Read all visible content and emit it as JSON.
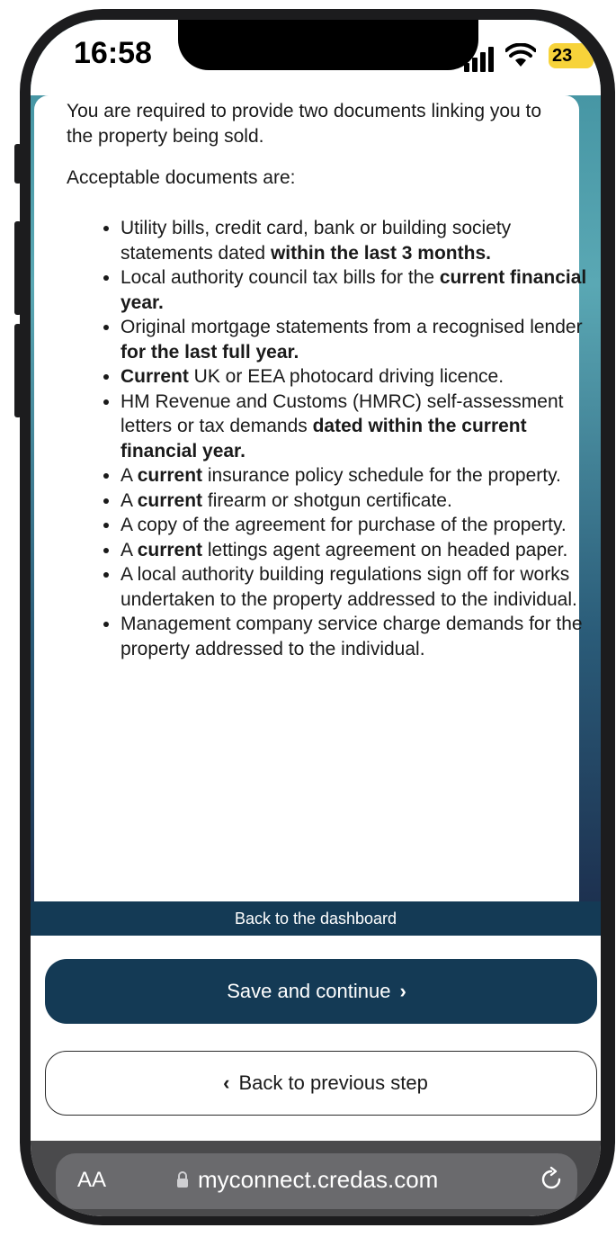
{
  "status_bar": {
    "time": "16:58",
    "battery": "23"
  },
  "content": {
    "intro": "You are required to provide two documents linking you to the property being sold.",
    "acceptable_heading": "Acceptable documents are:",
    "documents": [
      {
        "pre": "Utility bills, credit card, bank or building society statements dated ",
        "bold": "within the last 3 months.",
        "post": ""
      },
      {
        "pre": "Local authority council tax bills for the ",
        "bold": "current financial year.",
        "post": ""
      },
      {
        "pre": "Original mortgage statements from a recognised lender ",
        "bold": "for the last full year.",
        "post": ""
      },
      {
        "pre": "",
        "bold": "Current",
        "post": " UK or EEA photocard driving licence."
      },
      {
        "pre": "HM Revenue and Customs (HMRC) self-assessment letters or tax demands ",
        "bold": "dated within the current financial year.",
        "post": ""
      },
      {
        "pre": "A ",
        "bold": "current",
        "post": " insurance policy schedule for the property."
      },
      {
        "pre": "A ",
        "bold": "current",
        "post": " firearm or shotgun certificate."
      },
      {
        "pre": "A copy of the agreement for purchase of the property.",
        "bold": "",
        "post": ""
      },
      {
        "pre": "A ",
        "bold": "current",
        "post": " lettings agent agreement on headed paper."
      },
      {
        "pre": "A local authority building regulations sign off for works undertaken to the property addressed to the individual.",
        "bold": "",
        "post": ""
      },
      {
        "pre": "Management company service charge demands for the property addressed to the individual.",
        "bold": "",
        "post": ""
      }
    ]
  },
  "actions": {
    "dashboard": "Back to the dashboard",
    "save": "Save and continue",
    "back": "Back to previous step"
  },
  "browser": {
    "text_size": "AA",
    "url": "myconnect.credas.com"
  },
  "colors": {
    "primary": "#143a55",
    "battery": "#f7d33a"
  },
  "icons": [
    "signal-icon",
    "wifi-icon",
    "battery-icon",
    "chevron-right-icon",
    "chevron-left-icon",
    "lock-icon",
    "reload-icon"
  ]
}
